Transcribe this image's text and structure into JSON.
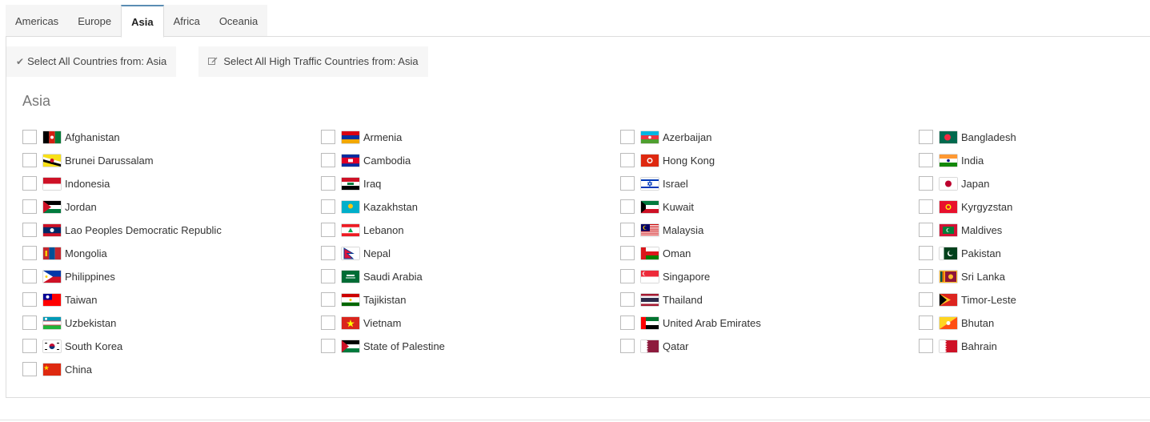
{
  "tabs": [
    {
      "label": "Americas",
      "active": false
    },
    {
      "label": "Europe",
      "active": false
    },
    {
      "label": "Asia",
      "active": true
    },
    {
      "label": "Africa",
      "active": false
    },
    {
      "label": "Oceania",
      "active": false
    }
  ],
  "actions": {
    "select_all": "Select All Countries from: Asia",
    "select_high_traffic": "Select All High Traffic Countries from: Asia"
  },
  "region_title": "Asia",
  "countries": [
    {
      "name": "Afghanistan",
      "flag": "af"
    },
    {
      "name": "Armenia",
      "flag": "am"
    },
    {
      "name": "Azerbaijan",
      "flag": "az"
    },
    {
      "name": "Bangladesh",
      "flag": "bd"
    },
    {
      "name": "Brunei Darussalam",
      "flag": "bn"
    },
    {
      "name": "Cambodia",
      "flag": "kh"
    },
    {
      "name": "Hong Kong",
      "flag": "hk"
    },
    {
      "name": "India",
      "flag": "in"
    },
    {
      "name": "Indonesia",
      "flag": "id"
    },
    {
      "name": "Iraq",
      "flag": "iq"
    },
    {
      "name": "Israel",
      "flag": "il"
    },
    {
      "name": "Japan",
      "flag": "jp"
    },
    {
      "name": "Jordan",
      "flag": "jo"
    },
    {
      "name": "Kazakhstan",
      "flag": "kz"
    },
    {
      "name": "Kuwait",
      "flag": "kw"
    },
    {
      "name": "Kyrgyzstan",
      "flag": "kg"
    },
    {
      "name": "Lao Peoples Democratic Republic",
      "flag": "la"
    },
    {
      "name": "Lebanon",
      "flag": "lb"
    },
    {
      "name": "Malaysia",
      "flag": "my"
    },
    {
      "name": "Maldives",
      "flag": "mv"
    },
    {
      "name": "Mongolia",
      "flag": "mn"
    },
    {
      "name": "Nepal",
      "flag": "np"
    },
    {
      "name": "Oman",
      "flag": "om"
    },
    {
      "name": "Pakistan",
      "flag": "pk"
    },
    {
      "name": "Philippines",
      "flag": "ph"
    },
    {
      "name": "Saudi Arabia",
      "flag": "sa"
    },
    {
      "name": "Singapore",
      "flag": "sg"
    },
    {
      "name": "Sri Lanka",
      "flag": "lk"
    },
    {
      "name": "Taiwan",
      "flag": "tw"
    },
    {
      "name": "Tajikistan",
      "flag": "tj"
    },
    {
      "name": "Thailand",
      "flag": "th"
    },
    {
      "name": "Timor-Leste",
      "flag": "tl"
    },
    {
      "name": "Uzbekistan",
      "flag": "uz"
    },
    {
      "name": "Vietnam",
      "flag": "vn"
    },
    {
      "name": "United Arab Emirates",
      "flag": "ae"
    },
    {
      "name": "Bhutan",
      "flag": "bt"
    },
    {
      "name": "South Korea",
      "flag": "kr"
    },
    {
      "name": "State of Palestine",
      "flag": "ps"
    },
    {
      "name": "Qatar",
      "flag": "qa"
    },
    {
      "name": "Bahrain",
      "flag": "bh"
    },
    {
      "name": "China",
      "flag": "cn"
    }
  ]
}
